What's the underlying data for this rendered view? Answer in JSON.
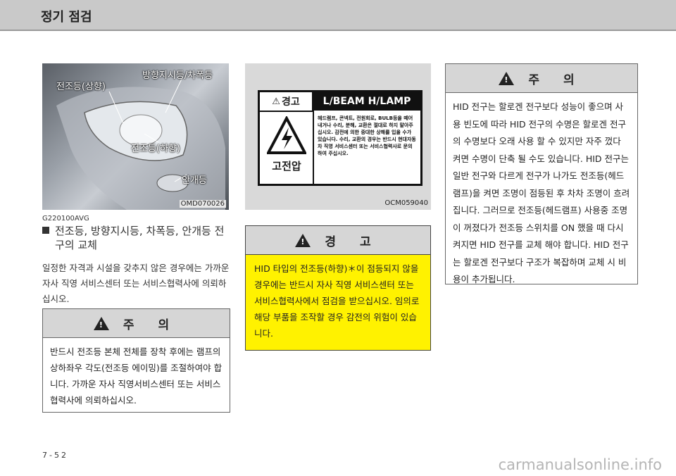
{
  "header": {
    "title": "정기 점검"
  },
  "photo": {
    "callouts": {
      "headlamp_high": "전조등(상향)",
      "turn_signal": "방향지시등/차폭등",
      "headlamp_low": "전조등(하향)",
      "fog_lamp": "안개등"
    },
    "code": "OMD070026"
  },
  "section": {
    "code": "G220100AVG",
    "title_line1": "전조등, 방향지시등, 차폭등, 안개등 전",
    "title_line2": "구의 교체",
    "body": "일정한 자격과 시설을 갖추지 않은 경우에는 가까운 자사 직영 서비스센터 또는 서비스협력사에 의뢰하십시오."
  },
  "caution_left": {
    "title": "주 의",
    "body": "반드시 전조등 본체 전체를 장착 후에는 램프의 상하좌우 각도(전조등 에이밍)를 조절하여야 합니다. 가까운 자사 직영서비스센터 또는 서비스협력사에 의뢰하십시오."
  },
  "label_panel": {
    "head_left": "경고",
    "head_right": "L/BEAM H/LAMP",
    "danger": "고전압",
    "text": "헤드램프, 콘넥트, 전원회로, BULB등을 떼어내거나 수리, 분해, 교환은 절대로 하지 말아주십시오. 감전에 의한 중대한 상해를 입을 수가 있습니다. 수리, 교환의 경우는 반드시 현대자동차 직영 서비스센터 또는 서비스협력사로 문의하여 주십시오.",
    "code": "OCM059040"
  },
  "warning_mid": {
    "title": "경 고",
    "body": "HID 타입의 전조등(하향)＊이 점등되지 않을 경우에는 반드시 자사 직영 서비스센터 또는 서비스협력사에서 점검을 받으십시오. 임의로 해당 부품을 조작할 경우 감전의 위험이 있습니다."
  },
  "caution_right": {
    "title": "주 의",
    "body": "HID 전구는 할로겐 전구보다 성능이 좋으며 사용 빈도에 따라 HID 전구의 수명은 할로겐 전구의 수명보다 오래 사용 할 수 있지만 자주 껐다 켜면 수명이 단축 될 수도 있습니다. HID 전구는 일반 전구와 다르게 전구가 나가도 전조등(헤드램프)을 켜면 조명이 점등된 후 차차 조명이 흐려집니다. 그러므로 전조등(헤드램프) 사용중 조명이 꺼졌다가 전조등 스위치를 ON 했을 때 다시 켜지면 HID 전구를 교체 해야 합니다. HID 전구는 할로겐 전구보다 구조가 복잡하며 교체 시 비용이 추가됩니다."
  },
  "footer": {
    "page_number": "7-52",
    "watermark": "carmanualsonline.info"
  }
}
